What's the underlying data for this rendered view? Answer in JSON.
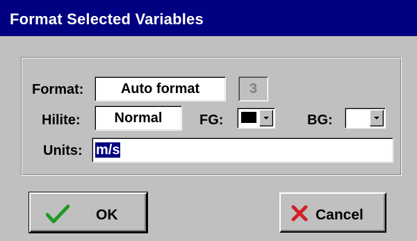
{
  "window": {
    "title": "Format Selected Variables"
  },
  "form": {
    "format_label": "Format:",
    "format_value": "Auto format",
    "digits_value": "3",
    "hilite_label": "Hilite:",
    "hilite_value": "Normal",
    "fg_label": "FG:",
    "fg_color": "#000000",
    "bg_label": "BG:",
    "bg_color": "#ffffff",
    "units_label": "Units:",
    "units_value": "m/s"
  },
  "buttons": {
    "ok_label": "OK",
    "cancel_label": "Cancel"
  },
  "icons": {
    "ok": "checkmark-icon",
    "cancel": "x-icon"
  },
  "colors": {
    "titlebar": "#000080",
    "dialog_bg": "#c0c0c0",
    "selection": "#000080",
    "check_green": "#1f9a22",
    "cancel_red": "#d0202a"
  }
}
